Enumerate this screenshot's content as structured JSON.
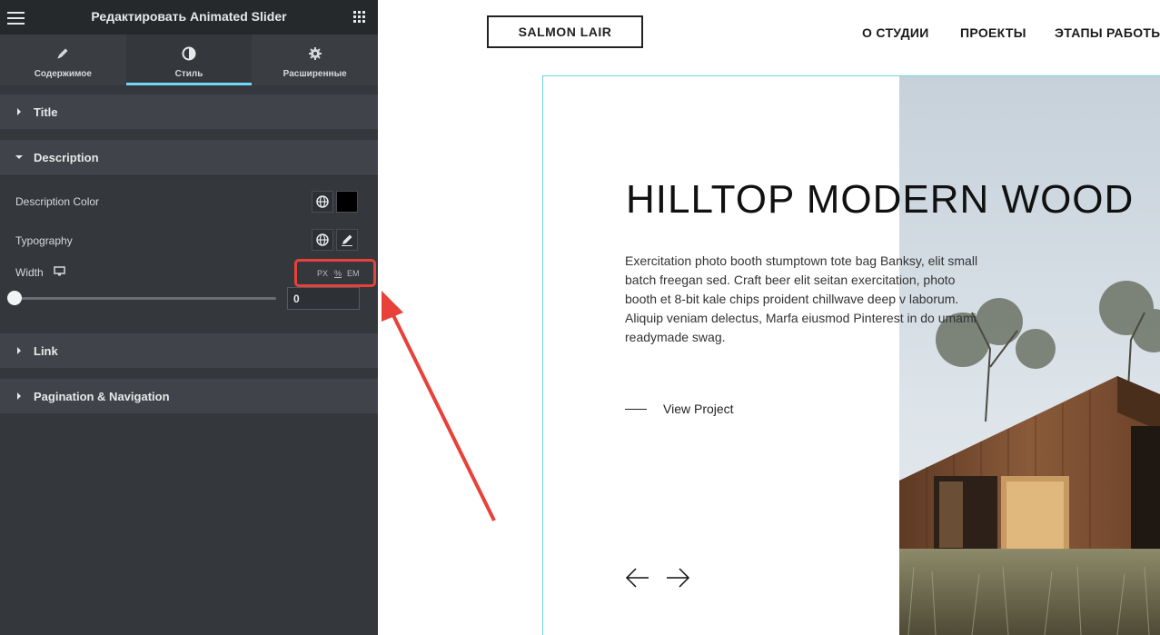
{
  "panel": {
    "title": "Редактировать Animated Slider",
    "tabs": [
      {
        "label": "Содержимое",
        "icon": "pencil-icon"
      },
      {
        "label": "Стиль",
        "icon": "half-circle-icon"
      },
      {
        "label": "Расширенные",
        "icon": "gear-icon"
      }
    ],
    "sections": {
      "title": "Title",
      "description": "Description",
      "link": "Link",
      "pagination": "Pagination & Navigation"
    },
    "description_color": {
      "label": "Description Color",
      "value": "#000000"
    },
    "typography": {
      "label": "Typography"
    },
    "width": {
      "label": "Width",
      "units": [
        "PX",
        "%",
        "EM"
      ],
      "value": "0"
    }
  },
  "preview": {
    "logo": "SALMON LAIR",
    "nav": [
      "О СТУДИИ",
      "ПРОЕКТЫ",
      "ЭТАПЫ РАБОТЫ"
    ],
    "slide": {
      "title": "HILLTOP MODERN WOOD",
      "description": "Exercitation photo booth stumptown tote bag Banksy, elit small batch freegan sed. Craft beer elit seitan exercitation, photo booth et 8-bit kale chips proident chillwave deep v laborum. Aliquip veniam delectus, Marfa eiusmod Pinterest in do umami readymade swag.",
      "link_label": "View Project"
    }
  },
  "colors": {
    "panel_bg": "#34383c",
    "active_tab_accent": "#71d7f7",
    "highlight": "#e8413a",
    "slide_border": "#6ed5df"
  }
}
